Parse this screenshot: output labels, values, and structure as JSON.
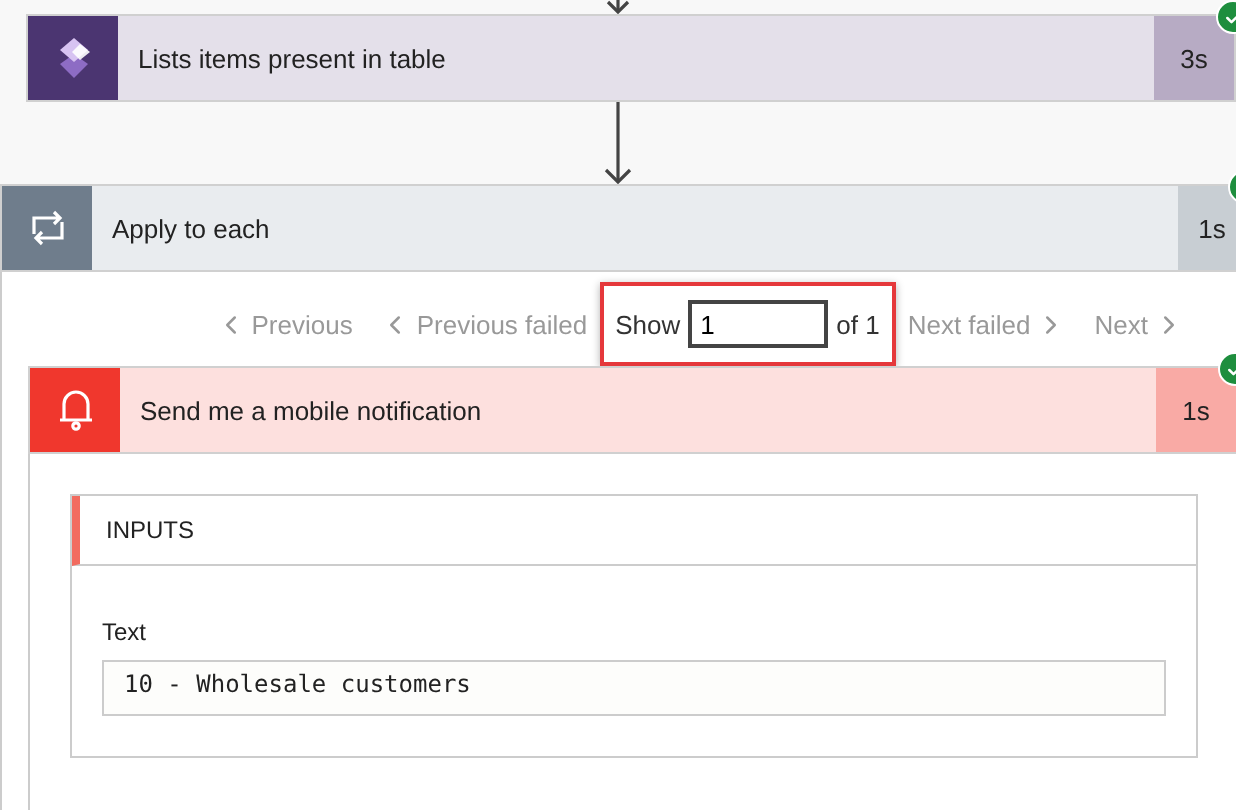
{
  "list_step": {
    "kind": "dataverse",
    "title": "Lists items present in table",
    "duration": "3s",
    "succeeded": true
  },
  "loop": {
    "kind": "loop",
    "title": "Apply to each",
    "duration": "1s",
    "succeeded": true,
    "pager": {
      "before": [
        {
          "label": "Previous",
          "kind": "prev",
          "disabled": true
        },
        {
          "label": "Previous failed",
          "kind": "prev",
          "disabled": true
        }
      ],
      "show": {
        "label": "Show",
        "value": "1",
        "total": "of 1",
        "highlighted": true
      },
      "after": [
        {
          "label": "Next failed",
          "kind": "next",
          "disabled": true
        },
        {
          "label": "Next",
          "kind": "next",
          "disabled": true
        }
      ]
    },
    "action": {
      "kind": "notification",
      "title": "Send me a mobile notification",
      "duration": "1s",
      "succeeded": true,
      "inputs": {
        "header": "INPUTS",
        "fields": [
          {
            "label": "Text",
            "value": "10 - Wholesale customers"
          }
        ]
      }
    }
  }
}
